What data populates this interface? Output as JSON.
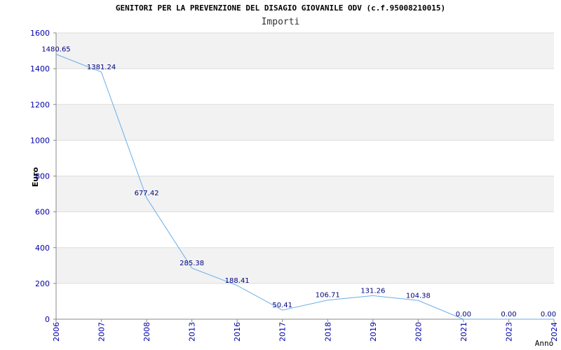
{
  "chart_data": {
    "type": "line",
    "title": "GENITORI PER LA PREVENZIONE DEL DISAGIO GIOVANILE ODV (c.f.95008210015)",
    "subtitle": "Importi",
    "xlabel": "Anno",
    "ylabel": "Euro",
    "categories": [
      "2006",
      "2007",
      "2008",
      "2013",
      "2016",
      "2017",
      "2018",
      "2019",
      "2020",
      "2021",
      "2023",
      "2024"
    ],
    "values": [
      1480.65,
      1381.24,
      677.42,
      285.38,
      188.41,
      50.41,
      106.71,
      131.26,
      104.38,
      0.0,
      0.0,
      0.0
    ],
    "value_labels": [
      "1480.65",
      "1381.24",
      "677.42",
      "285.38",
      "188.41",
      "50.41",
      "106.71",
      "131.26",
      "104.38",
      "0.00",
      "0.00",
      "0.00"
    ],
    "yticks": [
      0,
      200,
      400,
      600,
      800,
      1000,
      1200,
      1400,
      1600
    ],
    "ylim": [
      0,
      1600
    ],
    "grid": true,
    "legend": "none",
    "colors": {
      "line": "#6aaee8",
      "band": "#f2f2f2",
      "grid": "#dddddd",
      "axis": "#888888",
      "tick_text": "#0000aa",
      "label_text": "#000080"
    }
  }
}
